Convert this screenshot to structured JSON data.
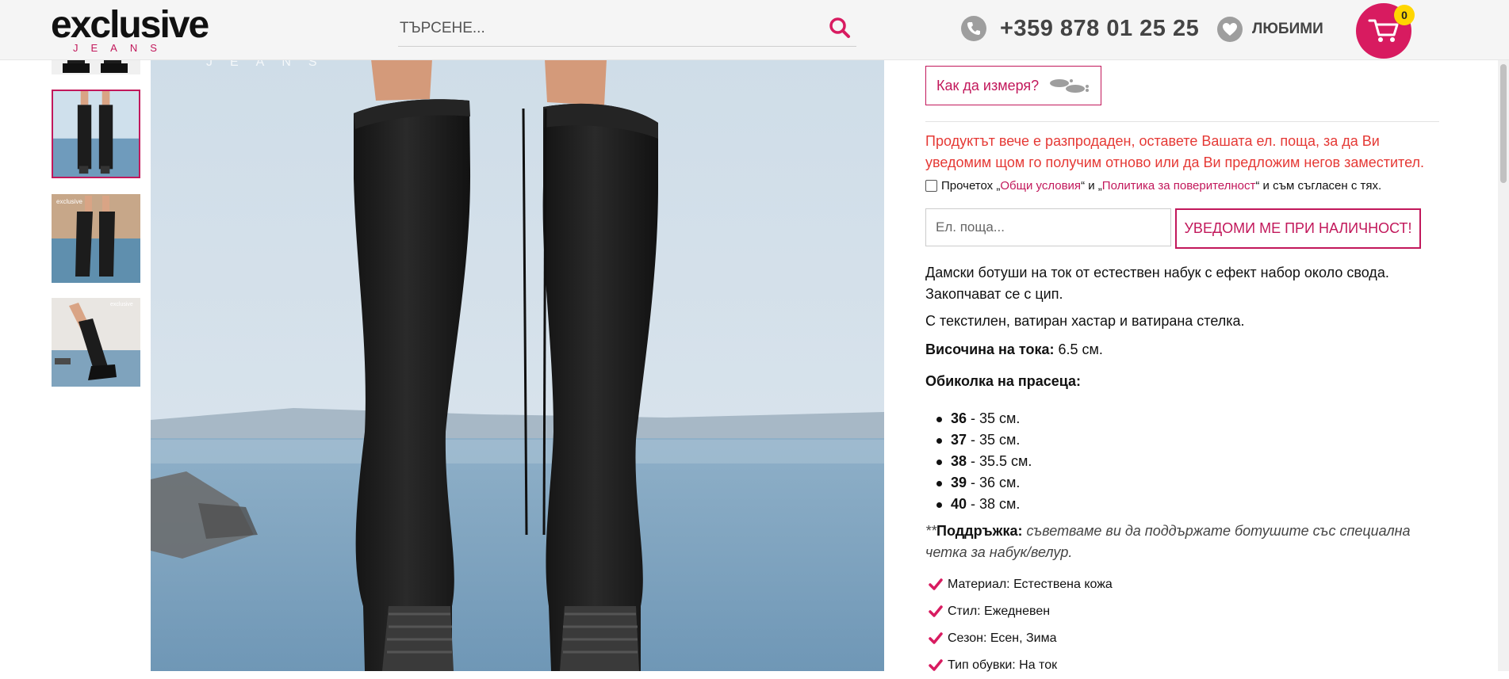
{
  "header": {
    "logo_text": "exclusive",
    "logo_sub": "JEANS",
    "search_placeholder": "ТЪРСЕНЕ...",
    "phone": "+359 878 01 25 25",
    "favorites_label": "ЛЮБИМИ",
    "cart_count": "0"
  },
  "gallery": {
    "thumbnails": [
      "boots-front",
      "boots-back",
      "boots-side-front",
      "boots-side"
    ],
    "active_index": 1
  },
  "product": {
    "measure_label": "Как да измеря?",
    "soldout_text": "Продуктът вече е разпродаден, оставете Вашата ел. поща, за да Ви уведомим щом го получим отново или да Ви предложим негов заместител.",
    "terms": {
      "prefix": "Прочетох „",
      "link1": "Общи условия",
      "middle": "“ и „",
      "link2": "Политика за поверителност",
      "suffix": "“ и съм съгласен с тях."
    },
    "email_placeholder": "Ел. поща...",
    "notify_label": "УВЕДОМИ МЕ ПРИ НАЛИЧНОСТ!",
    "description_1": "Дамски ботуши на ток от естествен набук с ефект набор около свода. Закопчават се с цип.",
    "description_2": "С текстилен, ватиран хастар и ватирана стелка.",
    "heel_label": "Височина на тока:",
    "heel_value": " 6.5 см.",
    "calf_label": "Обиколка на прасеца:",
    "sizes": [
      {
        "size": "36",
        "value": " - 35 см."
      },
      {
        "size": "37",
        "value": " - 35 см."
      },
      {
        "size": "38",
        "value": " - 35.5 см."
      },
      {
        "size": "39",
        "value": " - 36 см."
      },
      {
        "size": "40",
        "value": " - 38 см."
      }
    ],
    "care_prefix": "**",
    "care_label": "Поддръжка:",
    "care_text": " съветваме ви да поддържате ботушите със специална четка за набук/велур.",
    "features": [
      "Материал: Естествена кожа",
      "Стил: Ежедневен",
      "Сезон: Есен, Зима",
      "Тип обувки: На ток"
    ]
  },
  "colors": {
    "accent": "#c2185b",
    "warning": "#e53935",
    "cart_badge": "#ffd600"
  }
}
